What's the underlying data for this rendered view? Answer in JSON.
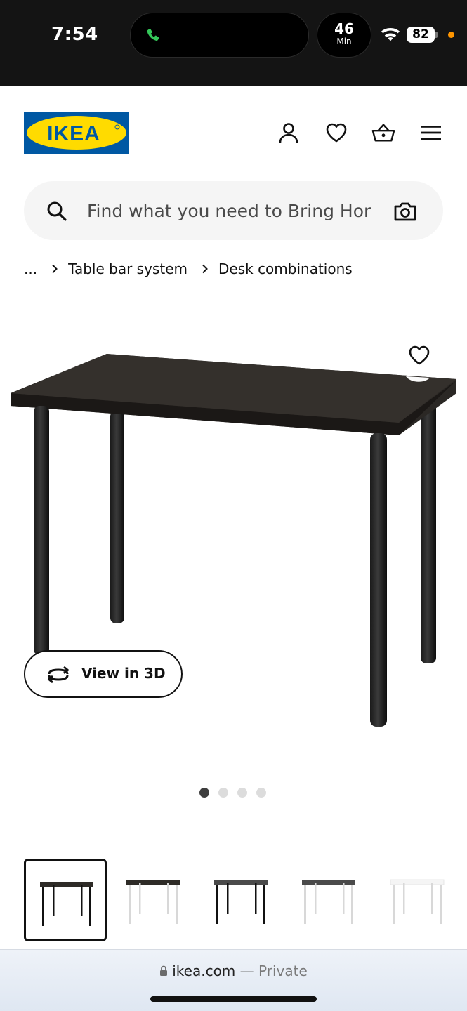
{
  "status_bar": {
    "time": "7:54",
    "timer_value": "46",
    "timer_unit": "Min",
    "battery": "82"
  },
  "header": {
    "logo_text": "IKEA",
    "brand_colors": {
      "blue": "#0058a3",
      "yellow": "#ffdb00"
    },
    "icons": [
      "profile-icon",
      "heart-icon",
      "basket-icon",
      "menu-icon"
    ]
  },
  "search": {
    "placeholder": "Find what you need to Bring Hor"
  },
  "breadcrumb": {
    "ellipsis": "...",
    "items": [
      "Table bar system",
      "Desk combinations"
    ]
  },
  "product": {
    "view_3d_label": "View in 3D",
    "carousel": {
      "total": 4,
      "active": 1
    },
    "thumbnails": [
      {
        "top": "#2e2b27",
        "legs": "#111111"
      },
      {
        "top": "#2e2b27",
        "legs": "#d8d8d8"
      },
      {
        "top": "#4a4a4a",
        "legs": "#111111"
      },
      {
        "top": "#4a4a4a",
        "legs": "#d8d8d8"
      },
      {
        "top": "#f5f5f5",
        "legs": "#d8d8d8"
      }
    ],
    "selected_thumbnail": 1
  },
  "browser": {
    "domain": "ikea.com",
    "separator": " — ",
    "mode": "Private"
  }
}
